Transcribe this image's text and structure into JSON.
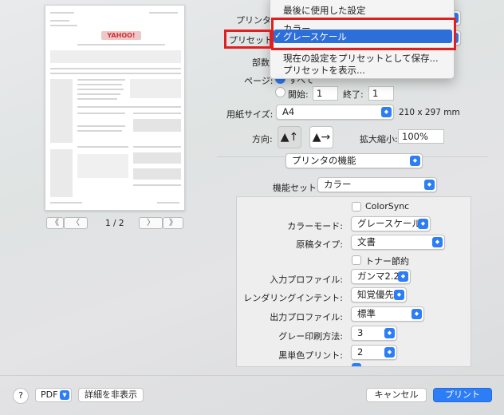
{
  "preview": {
    "logo_text": "YAHOO!",
    "page_indicator": "1 / 2",
    "nav_first": "《",
    "nav_prev": "〈",
    "nav_next": "〉",
    "nav_last": "》"
  },
  "printer": {
    "label": "プリンタ"
  },
  "presets": {
    "label": "プリセット",
    "menu": {
      "recent": "最後に使用した設定",
      "color": "カラー",
      "grayscale": "グレースケール",
      "check": "✓",
      "save": "現在の設定をプリセットとして保存...",
      "show": "プリセットを表示..."
    }
  },
  "copies": {
    "label": "部数"
  },
  "pages": {
    "label": "ページ:",
    "all": "すべて",
    "from_label": "開始:",
    "from_value": "1",
    "to_label": "終了:",
    "to_value": "1"
  },
  "paper": {
    "label": "用紙サイズ:",
    "value": "A4",
    "dims": "210 x 297 mm"
  },
  "orientation": {
    "label": "方向:",
    "portrait_icon": "▲↑",
    "landscape_icon": "▲→"
  },
  "scale": {
    "label": "拡大縮小:",
    "value": "100%"
  },
  "section": {
    "value": "プリンタの機能"
  },
  "feature_set": {
    "label": "機能セット:",
    "value": "カラー"
  },
  "panel": {
    "colorsync": "ColorSync",
    "color_mode_label": "カラーモード:",
    "color_mode_value": "グレースケール",
    "doc_type_label": "原稿タイプ:",
    "doc_type_value": "文書",
    "toner_save": "トナー節約",
    "input_profile_label": "入力プロファイル:",
    "input_profile_value": "ガンマ2.2",
    "rendering_label": "レンダリングインテント:",
    "rendering_value": "知覚優先",
    "output_profile_label": "出力プロファイル:",
    "output_profile_value": "標準",
    "gray_method_label": "グレー印刷方法:",
    "gray_method_value": "3",
    "black_print_label": "黒単色プリント:",
    "black_print_value": "2"
  },
  "footer": {
    "help": "?",
    "pdf": "PDF",
    "hide_details": "詳細を非表示",
    "cancel": "キャンセル",
    "print": "プリント"
  },
  "colors": {
    "accent": "#2d7df6",
    "highlight": "#e02020"
  }
}
